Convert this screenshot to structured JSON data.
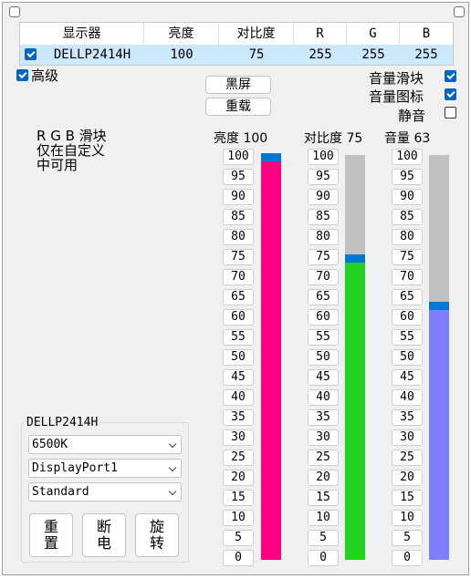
{
  "monitor_table": {
    "headers": [
      "显示器",
      "亮度",
      "对比度",
      "R",
      "G",
      "B"
    ],
    "row": {
      "checked": true,
      "cells": [
        "DELLP2414H",
        "100",
        "75",
        "255",
        "255",
        "255"
      ]
    }
  },
  "advanced": {
    "label": "高级",
    "checked": true
  },
  "buttons": {
    "black_screen": "黑屏",
    "reload": "重载"
  },
  "options": [
    {
      "label": "音量滑块",
      "checked": true
    },
    {
      "label": "音量图标",
      "checked": true
    },
    {
      "label": "静音",
      "checked": false
    }
  ],
  "rgb_note": [
    "R G B 滑块",
    "仅在自定义",
    "中可用"
  ],
  "sliders": [
    {
      "label": "亮度 100",
      "value": 100,
      "fill_color": "#ff0080"
    },
    {
      "label": "对比度 75",
      "value": 75,
      "fill_color": "#22d322"
    },
    {
      "label": "音量 63",
      "value": 63,
      "fill_color": "#8080ff"
    }
  ],
  "tick_labels": [
    "100",
    "95",
    "90",
    "85",
    "80",
    "75",
    "70",
    "65",
    "60",
    "55",
    "50",
    "45",
    "40",
    "35",
    "30",
    "25",
    "20",
    "15",
    "10",
    "5",
    "0"
  ],
  "monitor_group": {
    "title": "DELLP2414H",
    "color_temp": "6500K",
    "input": "DisplayPort1",
    "mode": "Standard",
    "reset": [
      "重",
      "置"
    ],
    "power": [
      "断",
      "电"
    ],
    "rotate": [
      "旋",
      "转"
    ]
  },
  "colors": {
    "accent": "#0078d4",
    "row_highlight": "#cce8ff"
  }
}
